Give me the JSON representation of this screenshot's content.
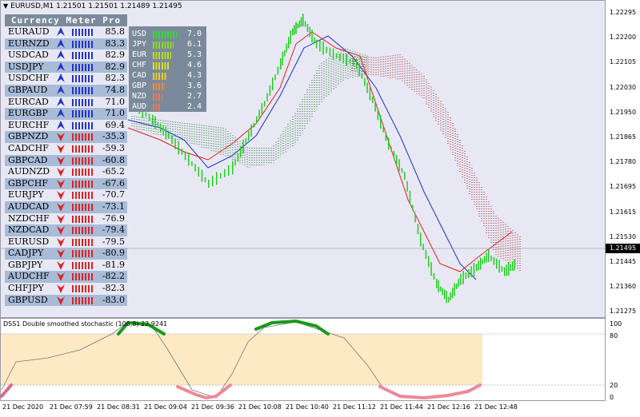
{
  "window": {
    "symbol_line": "EURUSD,M1  1.21501 1.21501 1.21489 1.21495"
  },
  "currency_meter": {
    "title": "Currency Meter Pro",
    "pairs": [
      {
        "name": "EURAUD",
        "value": "85.8",
        "trend": "up"
      },
      {
        "name": "EURNZD",
        "value": "83.3",
        "trend": "up"
      },
      {
        "name": "USDCAD",
        "value": "82.9",
        "trend": "up"
      },
      {
        "name": "USDJPY",
        "value": "82.9",
        "trend": "up"
      },
      {
        "name": "USDCHF",
        "value": "82.3",
        "trend": "up"
      },
      {
        "name": "GBPAUD",
        "value": "74.8",
        "trend": "up"
      },
      {
        "name": "EURCAD",
        "value": "71.0",
        "trend": "up"
      },
      {
        "name": "EURGBP",
        "value": "71.0",
        "trend": "up"
      },
      {
        "name": "EURCHF",
        "value": "69.4",
        "trend": "up"
      },
      {
        "name": "GBPNZD",
        "value": "-35.3",
        "trend": "down"
      },
      {
        "name": "CADCHF",
        "value": "-59.3",
        "trend": "down"
      },
      {
        "name": "GBPCAD",
        "value": "-60.8",
        "trend": "down"
      },
      {
        "name": "AUDNZD",
        "value": "-65.2",
        "trend": "down"
      },
      {
        "name": "GBPCHF",
        "value": "-67.6",
        "trend": "down"
      },
      {
        "name": "EURJPY",
        "value": "-70.7",
        "trend": "down"
      },
      {
        "name": "AUDCAD",
        "value": "-73.1",
        "trend": "down"
      },
      {
        "name": "NZDCHF",
        "value": "-76.9",
        "trend": "down"
      },
      {
        "name": "NZDCAD",
        "value": "-79.4",
        "trend": "down"
      },
      {
        "name": "EURUSD",
        "value": "-79.5",
        "trend": "down"
      },
      {
        "name": "CADJPY",
        "value": "-80.9",
        "trend": "down"
      },
      {
        "name": "GBPJPY",
        "value": "-81.9",
        "trend": "down"
      },
      {
        "name": "AUDCHF",
        "value": "-82.2",
        "trend": "down"
      },
      {
        "name": "CHFJPY",
        "value": "-82.3",
        "trend": "down"
      },
      {
        "name": "GBPUSD",
        "value": "-83.0",
        "trend": "down"
      }
    ],
    "currencies": [
      {
        "name": "USD",
        "value": "7.0",
        "color": "#33dd33"
      },
      {
        "name": "JPY",
        "value": "6.1",
        "color": "#88dd22"
      },
      {
        "name": "EUR",
        "value": "5.3",
        "color": "#bbdd22"
      },
      {
        "name": "CHF",
        "value": "4.6",
        "color": "#dddd22"
      },
      {
        "name": "CAD",
        "value": "4.3",
        "color": "#eecc22"
      },
      {
        "name": "GBP",
        "value": "3.6",
        "color": "#ee8844"
      },
      {
        "name": "NZD",
        "value": "2.7",
        "color": "#ee7755"
      },
      {
        "name": "AUD",
        "value": "2.4",
        "color": "#ee7755"
      }
    ],
    "up_color": "#2233cc",
    "down_color": "#dd2222"
  },
  "price_scale": {
    "labels": [
      "1.22295",
      "1.22200",
      "1.22105",
      "1.22030",
      "1.21950",
      "1.21865",
      "1.21780",
      "1.21695",
      "1.21615",
      "1.21530",
      "1.21445",
      "1.21360",
      "1.21275"
    ],
    "current": "1.21495"
  },
  "indicator": {
    "title": "DSS1 Double smoothed stochastic (100,8) 22.9241",
    "labels": [
      "100",
      "80",
      "20",
      "0"
    ]
  },
  "time_scale": {
    "labels": [
      "21 Dec 2020",
      "21 Dec 07:59",
      "21 Dec 08:31",
      "21 Dec 09:04",
      "21 Dec 09:36",
      "21 Dec 10:08",
      "21 Dec 10:40",
      "21 Dec 11:12",
      "21 Dec 11:44",
      "21 Dec 12:16",
      "21 Dec 12:48"
    ]
  }
}
